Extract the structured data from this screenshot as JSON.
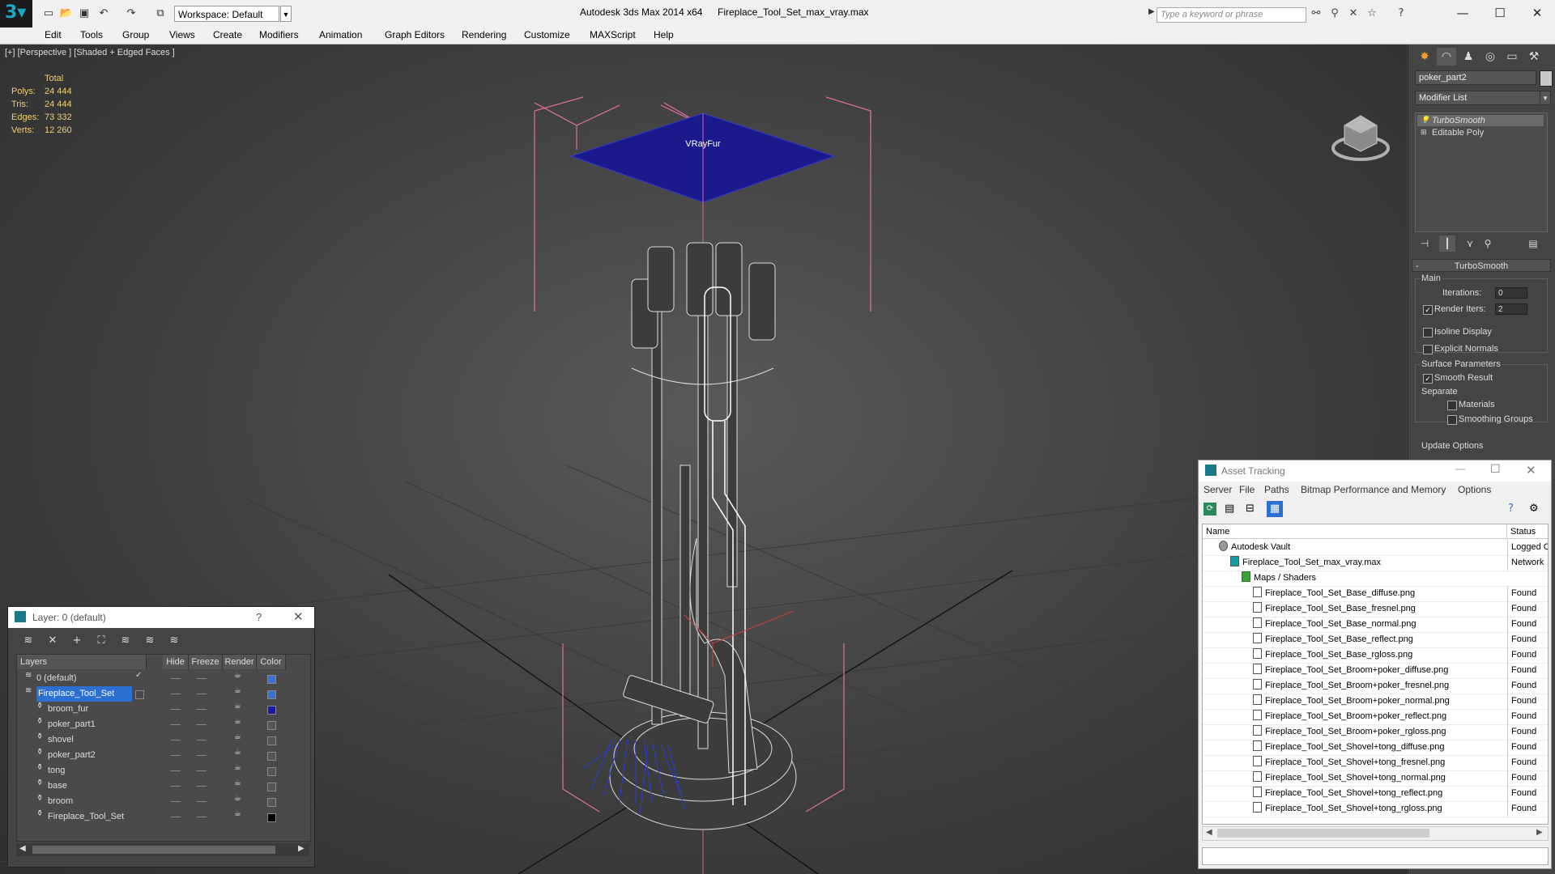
{
  "titlebar": {
    "workspace": "Workspace: Default",
    "app_title": "Autodesk 3ds Max  2014 x64",
    "file_title": "Fireplace_Tool_Set_max_vray.max",
    "search_placeholder": "Type a keyword or phrase"
  },
  "menu": [
    "Edit",
    "Tools",
    "Group",
    "Views",
    "Create",
    "Modifiers",
    "Animation",
    "Graph Editors",
    "Rendering",
    "Customize",
    "MAXScript",
    "Help"
  ],
  "viewport": {
    "label": "[+] [Perspective ] [Shaded + Edged Faces ]",
    "stats_header": "Total",
    "stats": [
      {
        "label": "Polys:",
        "value": "24 444"
      },
      {
        "label": "Tris:",
        "value": "24 444"
      },
      {
        "label": "Edges:",
        "value": "73 332"
      },
      {
        "label": "Verts:",
        "value": "12 260"
      }
    ],
    "vrayfur_label": "VRayFur"
  },
  "command_panel": {
    "object_name": "poker_part2",
    "modifier_list": "Modifier List",
    "stack": [
      "TurboSmooth",
      "Editable Poly"
    ],
    "rollout_title": "TurboSmooth",
    "main_label": "Main",
    "iterations_label": "Iterations:",
    "iterations_value": "0",
    "render_iters_label": "Render Iters:",
    "render_iters_value": "2",
    "isoline_label": "Isoline Display",
    "explicit_normals_label": "Explicit Normals",
    "surface_params_label": "Surface Parameters",
    "smooth_result_label": "Smooth Result",
    "separate_label": "Separate",
    "materials_label": "Materials",
    "smoothing_groups_label": "Smoothing Groups",
    "update_options_label": "Update Options"
  },
  "layer_dialog": {
    "title": "Layer: 0 (default)",
    "help": "?",
    "columns": [
      "Layers",
      "Hide",
      "Freeze",
      "Render",
      "Color"
    ],
    "rows": [
      {
        "name": "0 (default)",
        "indent": 1,
        "color": "#3b6fd8",
        "active": true,
        "selected": false
      },
      {
        "name": "Fireplace_Tool_Set",
        "indent": 1,
        "color": "#3b6fd8",
        "active": false,
        "selected": true
      },
      {
        "name": "broom_fur",
        "indent": 2,
        "color": "#1a1ab0",
        "active": false,
        "selected": false
      },
      {
        "name": "poker_part1",
        "indent": 2,
        "color": "#555555",
        "active": false,
        "selected": false
      },
      {
        "name": "shovel",
        "indent": 2,
        "color": "#555555",
        "active": false,
        "selected": false
      },
      {
        "name": "poker_part2",
        "indent": 2,
        "color": "#555555",
        "active": false,
        "selected": false
      },
      {
        "name": "tong",
        "indent": 2,
        "color": "#555555",
        "active": false,
        "selected": false
      },
      {
        "name": "base",
        "indent": 2,
        "color": "#555555",
        "active": false,
        "selected": false
      },
      {
        "name": "broom",
        "indent": 2,
        "color": "#555555",
        "active": false,
        "selected": false
      },
      {
        "name": "Fireplace_Tool_Set",
        "indent": 2,
        "color": "#000000",
        "active": false,
        "selected": false
      }
    ]
  },
  "asset_tracking": {
    "title": "Asset Tracking",
    "menu": [
      "Server",
      "File",
      "Paths",
      "Bitmap Performance and Memory",
      "Options"
    ],
    "columns": [
      "Name",
      "Status"
    ],
    "rows": [
      {
        "name": "Autodesk Vault",
        "status": "Logged Out",
        "level": 0,
        "type": "vault"
      },
      {
        "name": "Fireplace_Tool_Set_max_vray.max",
        "status": "Network",
        "level": 1,
        "type": "max"
      },
      {
        "name": "Maps / Shaders",
        "status": "",
        "level": 2,
        "type": "maps"
      },
      {
        "name": "Fireplace_Tool_Set_Base_diffuse.png",
        "status": "Found",
        "level": 3,
        "type": "file"
      },
      {
        "name": "Fireplace_Tool_Set_Base_fresnel.png",
        "status": "Found",
        "level": 3,
        "type": "file"
      },
      {
        "name": "Fireplace_Tool_Set_Base_normal.png",
        "status": "Found",
        "level": 3,
        "type": "file"
      },
      {
        "name": "Fireplace_Tool_Set_Base_reflect.png",
        "status": "Found",
        "level": 3,
        "type": "file"
      },
      {
        "name": "Fireplace_Tool_Set_Base_rgloss.png",
        "status": "Found",
        "level": 3,
        "type": "file"
      },
      {
        "name": "Fireplace_Tool_Set_Broom+poker_diffuse.png",
        "status": "Found",
        "level": 3,
        "type": "file"
      },
      {
        "name": "Fireplace_Tool_Set_Broom+poker_fresnel.png",
        "status": "Found",
        "level": 3,
        "type": "file"
      },
      {
        "name": "Fireplace_Tool_Set_Broom+poker_normal.png",
        "status": "Found",
        "level": 3,
        "type": "file"
      },
      {
        "name": "Fireplace_Tool_Set_Broom+poker_reflect.png",
        "status": "Found",
        "level": 3,
        "type": "file"
      },
      {
        "name": "Fireplace_Tool_Set_Broom+poker_rgloss.png",
        "status": "Found",
        "level": 3,
        "type": "file"
      },
      {
        "name": "Fireplace_Tool_Set_Shovel+tong_diffuse.png",
        "status": "Found",
        "level": 3,
        "type": "file"
      },
      {
        "name": "Fireplace_Tool_Set_Shovel+tong_fresnel.png",
        "status": "Found",
        "level": 3,
        "type": "file"
      },
      {
        "name": "Fireplace_Tool_Set_Shovel+tong_normal.png",
        "status": "Found",
        "level": 3,
        "type": "file"
      },
      {
        "name": "Fireplace_Tool_Set_Shovel+tong_reflect.png",
        "status": "Found",
        "level": 3,
        "type": "file"
      },
      {
        "name": "Fireplace_Tool_Set_Shovel+tong_rgloss.png",
        "status": "Found",
        "level": 3,
        "type": "file"
      }
    ]
  },
  "colors": {
    "selection_blue": "#3399ff",
    "stats_yellow": "#f0d070",
    "vrayfur_plane": "#1a1a8c",
    "bbox_pink": "#e070a0"
  }
}
